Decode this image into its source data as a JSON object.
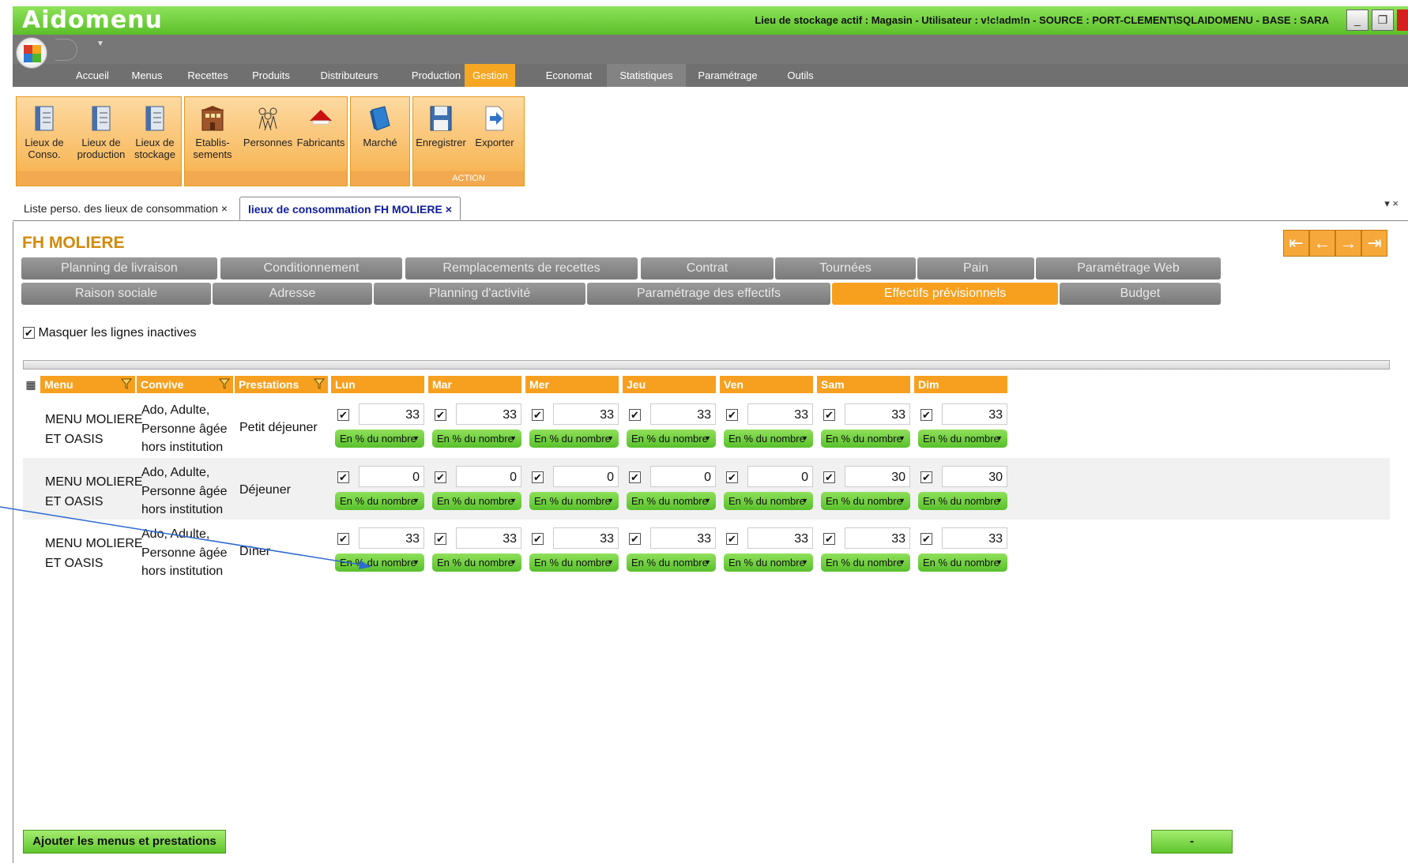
{
  "window": {
    "app_title": "Aidomenu",
    "status_text": "Lieu de stockage actif : Magasin - Utilisateur : v!c!adm!n - SOURCE : PORT-CLEMENT\\SQLAIDOMENU - BASE : SARA",
    "minimize": "_",
    "restore": "❐"
  },
  "menu": {
    "tabs": [
      "Accueil",
      "Menus",
      "Recettes",
      "Produits",
      "Distributeurs",
      "Production",
      "Gestion",
      "Economat",
      "Statistiques",
      "Paramétrage",
      "Outils"
    ],
    "active": "Gestion"
  },
  "ribbon": {
    "lieux_conso": "Lieux de Conso.",
    "lieux_production": "Lieux de production",
    "lieux_stockage": "Lieux de stockage",
    "etablissements": "Etablis-sements",
    "personnes": "Personnes",
    "fabricants": "Fabricants",
    "marche": "Marché",
    "enregistrer": "Enregistrer",
    "exporter": "Exporter",
    "action_group": "ACTION"
  },
  "doc_tabs": {
    "tab1": "Liste perso. des lieux de consommation",
    "tab2": "lieux de consommation FH MOLIERE",
    "close": "×"
  },
  "page": {
    "title": "FH MOLIERE",
    "tabs_row1": [
      "Planning de livraison",
      "Conditionnement",
      "Remplacements de recettes",
      "Contrat",
      "Tournées",
      "Pain",
      "Paramétrage Web"
    ],
    "tabs_row2": [
      "Raison sociale",
      "Adresse",
      "Planning d'activité",
      "Paramétrage des effectifs",
      "Effectifs prévisionnels",
      "Budget"
    ],
    "active_tab": "Effectifs prévisionnels",
    "hide_inactive_label": "Masquer les lignes inactives",
    "hide_inactive_checked": true
  },
  "grid": {
    "columns": [
      "Menu",
      "Convive",
      "Prestations",
      "Lun",
      "Mar",
      "Mer",
      "Jeu",
      "Ven",
      "Sam",
      "Dim"
    ],
    "rows": [
      {
        "menu_line1": "MENU MOLIERE",
        "menu_line2": "ET OASIS",
        "convive_line1": "Ado, Adulte,",
        "convive_line2": "Personne âgée",
        "convive_line3": "hors institution",
        "prestation": "Petit déjeuner",
        "values": [
          "33",
          "33",
          "33",
          "33",
          "33",
          "33",
          "33"
        ],
        "mode": "En % du nombre"
      },
      {
        "menu_line1": "MENU MOLIERE",
        "menu_line2": "ET OASIS",
        "convive_line1": "Ado, Adulte,",
        "convive_line2": "Personne âgée",
        "convive_line3": "hors institution",
        "prestation": "Déjeuner",
        "values": [
          "0",
          "0",
          "0",
          "0",
          "0",
          "30",
          "30"
        ],
        "mode": "En % du nombre"
      },
      {
        "menu_line1": "MENU MOLIERE",
        "menu_line2": "ET OASIS",
        "convive_line1": "Ado, Adulte,",
        "convive_line2": "Personne âgée",
        "convive_line3": "hors institution",
        "prestation": "Dîner",
        "values": [
          "33",
          "33",
          "33",
          "33",
          "33",
          "33",
          "33"
        ],
        "mode": "En % du nombre"
      }
    ]
  },
  "buttons": {
    "add": "Ajouter les menus et prestations",
    "remove": "-"
  },
  "colors": {
    "accent": "#f7a01f",
    "green": "#5cbf2a",
    "annotation": "#2e6ad1"
  }
}
